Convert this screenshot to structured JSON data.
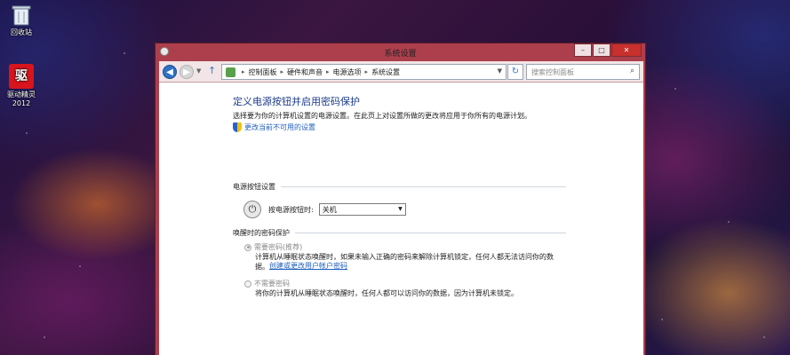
{
  "desktop": {
    "icons": [
      {
        "label": "回收站",
        "icon": "recycle-bin-icon"
      },
      {
        "label": "驱动精灵\n2012",
        "icon": "app-icon"
      }
    ]
  },
  "window": {
    "title": "系统设置",
    "caption_buttons": {
      "minimize": "–",
      "maximize": "□",
      "close": "✕"
    }
  },
  "navbar": {
    "breadcrumb": [
      "控制面板",
      "硬件和声音",
      "电源选项",
      "系统设置"
    ],
    "search_placeholder": "搜索控制面板"
  },
  "content": {
    "heading": "定义电源按钮并启用密码保护",
    "description": "选择要为你的计算机设置的电源设置。在此页上对设置所做的更改将应用于你所有的电源计划。",
    "change_link": "更改当前不可用的设置",
    "power_section": {
      "title": "电源按钮设置",
      "power_label": "按电源按钮时:",
      "power_value": "关机"
    },
    "wake_section": {
      "title": "唤醒时的密码保护",
      "option1_label": "需要密码(推荐)",
      "option1_text_line1": "计算机从睡眠状态唤醒时，如果未输入正确的密码来解除计算机锁定，任何人都无法访问你的数",
      "option1_text_line2": "据。",
      "option1_link": "创建或更改用户帐户密码",
      "option2_label": "不需要密码",
      "option2_text": "将你的计算机从睡眠状态唤醒时，任何人都可以访问你的数据，因为计算机未锁定。"
    }
  }
}
